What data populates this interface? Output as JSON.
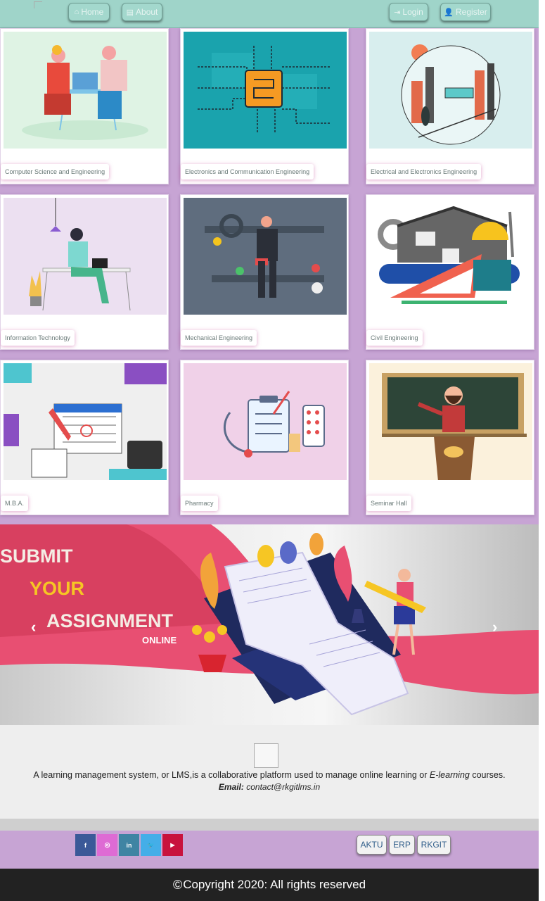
{
  "nav": {
    "home": "Home",
    "about": "About",
    "login": "Login",
    "register": "Register"
  },
  "courses": [
    {
      "label": "Computer Science and Engineering"
    },
    {
      "label": "Electronics and Communication Engineering"
    },
    {
      "label": "Electrical and Electronics Engineering"
    },
    {
      "label": "Information Technology"
    },
    {
      "label": "Mechanical Engineering"
    },
    {
      "label": "Civil Engineering"
    },
    {
      "label": "M.B.A."
    },
    {
      "label": "Pharmacy"
    },
    {
      "label": "Seminar Hall"
    }
  ],
  "carousel": {
    "line1": "SUBMIT",
    "line2": "YOUR",
    "line3": "ASSIGNMENT",
    "line4": "ONLINE",
    "prev": "‹",
    "next": "›"
  },
  "footer": {
    "description_prefix": "A learning management system, or LMS,is a collaborative platform used to manage online learning or ",
    "description_em": "E-learning",
    "description_suffix": " courses.",
    "email_label": "Email:",
    "email": "contact@rkgitlms.in",
    "social": [
      {
        "icon": "facebook-icon",
        "glyph": "f",
        "color": "#3b5998"
      },
      {
        "icon": "instagram-icon",
        "glyph": "◎",
        "color": "#de6bd4"
      },
      {
        "icon": "linkedin-icon",
        "glyph": "in",
        "color": "#3f84a3"
      },
      {
        "icon": "twitter-icon",
        "glyph": "🐦",
        "color": "#44aee8"
      },
      {
        "icon": "youtube-icon",
        "glyph": "▶",
        "color": "#c8123d"
      }
    ],
    "links": {
      "aktu": "AKTU",
      "erp": "ERP",
      "rkgit": "RKGIT"
    },
    "copyright": "Copyright 2020: All rights reserved"
  }
}
